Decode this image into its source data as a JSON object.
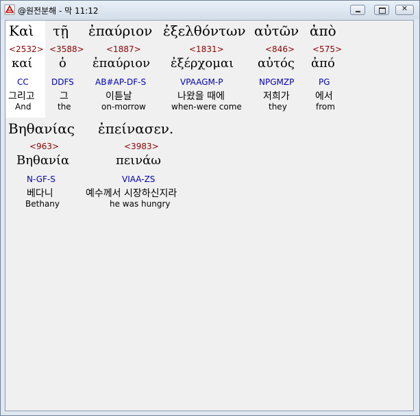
{
  "window": {
    "title": "@원전분해 - 막 11:12"
  },
  "rows": [
    [
      {
        "greek": "Καὶ",
        "number": "<2532>",
        "lemma": "καί",
        "parsing": "CC",
        "korean": "그리고",
        "english": "And"
      },
      {
        "greek": "τῇ",
        "number": "<3588>",
        "lemma": "ὁ",
        "parsing": "DDFS",
        "korean": "그",
        "english": "the"
      },
      {
        "greek": "ἐπαύριον",
        "number": "<1887>",
        "lemma": "ἐπαύριον",
        "parsing": "AB#AP-DF-S",
        "korean": "이튿날",
        "english": "on-morrow"
      },
      {
        "greek": "ἐξελθόντων",
        "number": "<1831>",
        "lemma": "ἐξέρχομαι",
        "parsing": "VPAAGM-P",
        "korean": "나왔을 때에",
        "english": "when-were come"
      },
      {
        "greek": "αὐτῶν",
        "number": "<846>",
        "lemma": "αὐτός",
        "parsing": "NPGMZP",
        "korean": "저희가",
        "english": "they"
      },
      {
        "greek": "ἀπὸ",
        "number": "<575>",
        "lemma": "ἀπό",
        "parsing": "PG",
        "korean": "에서",
        "english": "from"
      }
    ],
    [
      {
        "greek": "Βηθανίας",
        "number": "<963>",
        "lemma": "Βηθανία",
        "parsing": "N-GF-S",
        "korean": "베다니",
        "english": "Bethany"
      },
      {
        "greek": "ἐπείνασεν.",
        "number": "<3983>",
        "lemma": "πεινάω",
        "parsing": "VIAA-ZS",
        "korean": "예수께서 시장하신지라",
        "english": "he was hungry"
      }
    ]
  ]
}
